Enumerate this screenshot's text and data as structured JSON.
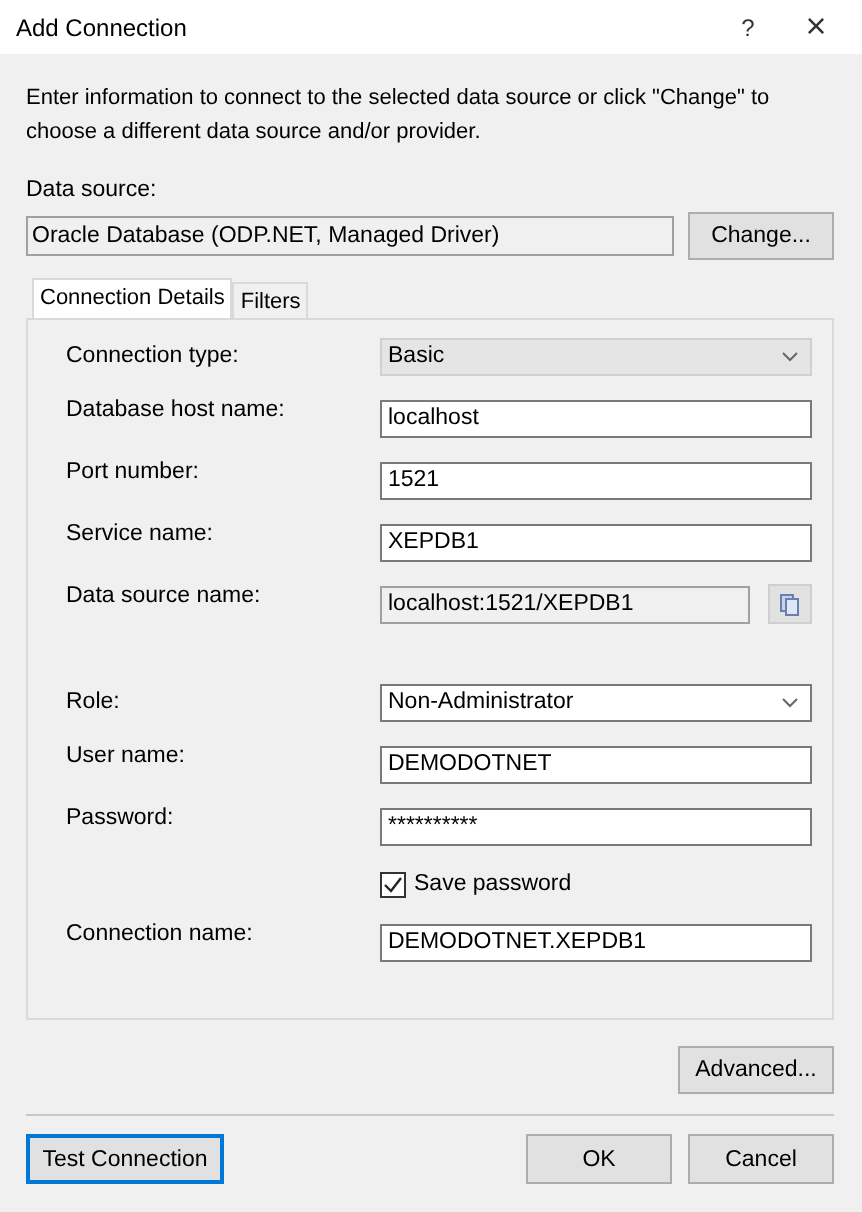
{
  "window": {
    "title": "Add Connection",
    "help": "?",
    "close": "×"
  },
  "intro": "Enter information to connect to the selected data source or click \"Change\" to choose a different data source and/or provider.",
  "data_source": {
    "label": "Data source:",
    "value": "Oracle Database (ODP.NET, Managed Driver)",
    "button": "Change..."
  },
  "tabs": [
    {
      "label": "Connection Details",
      "selected": true
    },
    {
      "label": "Filters",
      "selected": false
    }
  ],
  "fields": [
    {
      "kind": "select",
      "label": "Connection type:",
      "value": "Basic"
    },
    {
      "kind": "text",
      "label": "Database host name:",
      "value": "localhost"
    },
    {
      "kind": "text",
      "label": "Port number:",
      "value": "1521"
    },
    {
      "kind": "text",
      "label": "Service name:",
      "value": "XEPDB1"
    },
    {
      "kind": "readonly",
      "label": "Data source name:",
      "value": "localhost:1521/XEPDB1"
    },
    {
      "kind": "combo",
      "label": "Role:",
      "value": "Non-Administrator"
    },
    {
      "kind": "text",
      "label": "User name:",
      "value": "DEMODOTNET"
    },
    {
      "kind": "password",
      "label": "Password:",
      "value": "**********"
    },
    {
      "kind": "checkbox",
      "label": "Save password",
      "checked": true
    },
    {
      "kind": "text",
      "label": "Connection name:",
      "value": "DEMODOTNET.XEPDB1"
    }
  ],
  "advanced_button": "Advanced...",
  "buttons": [
    {
      "label": "Test Connection",
      "focused": true
    },
    {
      "label": "OK",
      "focused": false
    },
    {
      "label": "Cancel",
      "focused": false
    }
  ]
}
